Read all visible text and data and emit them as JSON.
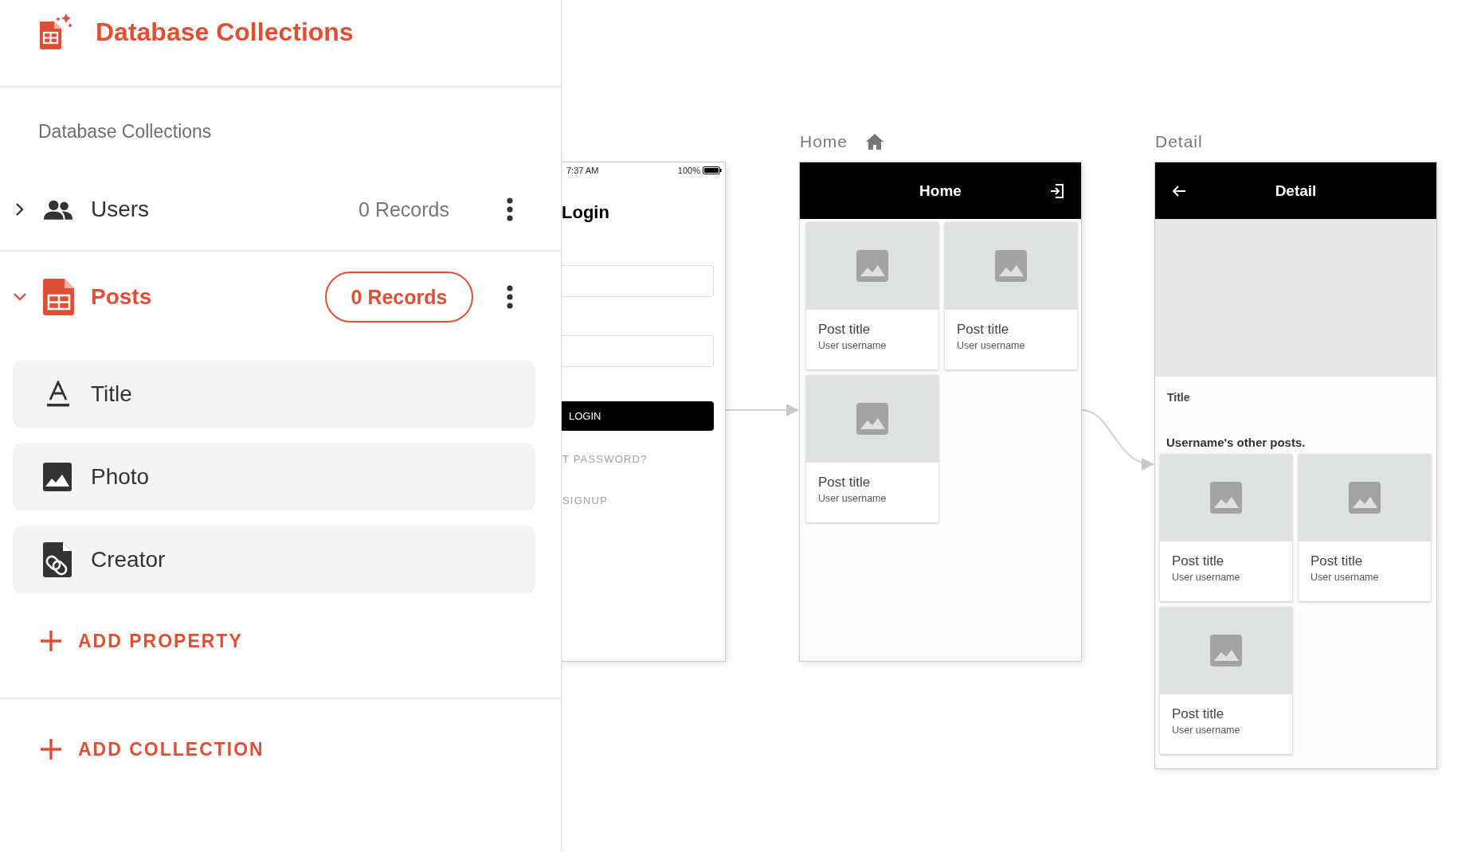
{
  "panel": {
    "title": "Database Collections",
    "section_label": "Database Collections",
    "collections": [
      {
        "name": "Users",
        "kind": "people",
        "records": "0 Records",
        "expanded": false
      },
      {
        "name": "Posts",
        "kind": "table",
        "records": "0 Records",
        "expanded": true,
        "properties": [
          {
            "name": "Title",
            "kind": "text"
          },
          {
            "name": "Photo",
            "kind": "image"
          },
          {
            "name": "Creator",
            "kind": "relation"
          }
        ],
        "add_property": "ADD PROPERTY"
      }
    ],
    "add_collection": "ADD COLLECTION"
  },
  "screens": [
    {
      "kind": "login",
      "status_time": "7:37 AM",
      "battery": "100%",
      "heading": "Login",
      "button": "LOGIN",
      "links": [
        "T PASSWORD?",
        "SIGNUP"
      ]
    },
    {
      "kind": "grid",
      "label": "Home",
      "header": "Home",
      "posts": [
        {
          "title": "Post title",
          "author": "User username"
        },
        {
          "title": "Post title",
          "author": "User username"
        },
        {
          "title": "Post title",
          "author": "User username"
        }
      ]
    },
    {
      "kind": "detail",
      "label": "Detail",
      "header": "Detail",
      "field_label": "Title",
      "section": "Username's other posts.",
      "posts": [
        {
          "title": "Post title",
          "author": "User username"
        },
        {
          "title": "Post title",
          "author": "User username"
        },
        {
          "title": "Post title",
          "author": "User username"
        }
      ]
    }
  ]
}
